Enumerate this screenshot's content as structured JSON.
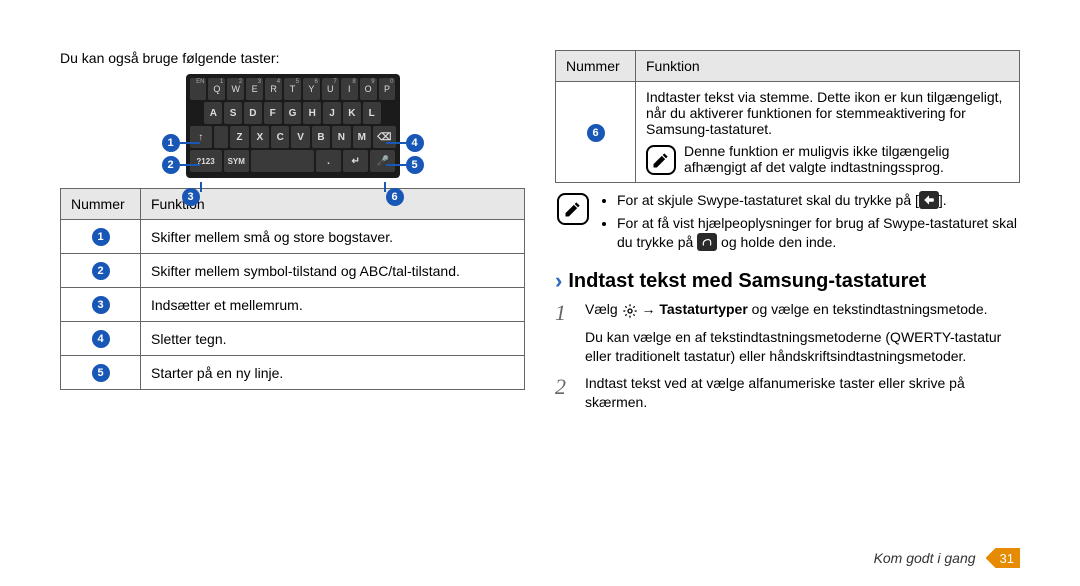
{
  "left": {
    "intro": "Du kan også bruge følgende taster:",
    "kb_rows": {
      "r1_sup": [
        "EN",
        "1",
        "2",
        "3",
        "4",
        "5",
        "6",
        "7",
        "8",
        "9",
        "0"
      ],
      "r1": [
        "",
        "Q",
        "W",
        "E",
        "R",
        "T",
        "Y",
        "U",
        "I",
        "O",
        "P"
      ],
      "r2_sup": [
        "",
        "",
        "#",
        "$",
        "%",
        "^",
        "*",
        "(",
        ")",
        "_"
      ],
      "r2": [
        "A",
        "S",
        "D",
        "F",
        "G",
        "H",
        "J",
        "K",
        "L"
      ],
      "r3": [
        "↑",
        "",
        "Z",
        "X",
        "C",
        "V",
        "B",
        "N",
        "M",
        "⌫"
      ],
      "r4": [
        "?123",
        "SYM",
        "",
        "",
        "",
        "↵",
        "🎤",
        ""
      ]
    },
    "tbl_head": {
      "num": "Nummer",
      "func": "Funktion"
    },
    "rows": [
      {
        "n": "1",
        "text": "Skifter mellem små og store bogstaver."
      },
      {
        "n": "2",
        "text": "Skifter mellem symbol-tilstand og ABC/tal-tilstand."
      },
      {
        "n": "3",
        "text": "Indsætter et mellemrum."
      },
      {
        "n": "4",
        "text": "Sletter tegn."
      },
      {
        "n": "5",
        "text": "Starter på en ny linje."
      }
    ]
  },
  "right": {
    "tbl_head": {
      "num": "Nummer",
      "func": "Funktion"
    },
    "row6": {
      "n": "6",
      "main": "Indtaster tekst via stemme. Dette ikon er kun tilgængeligt, når du aktiverer funktionen for stemmeaktivering for Samsung-tastaturet.",
      "note": "Denne funktion er muligvis ikke tilgængelig afhængigt af det valgte indtastningssprog."
    },
    "tips": {
      "b1a": "For at skjule Swype-tastaturet skal du trykke på [",
      "b1b": "].",
      "b2a": "For at få vist hjælpeoplysninger for brug af Swype-tastaturet skal du trykke på ",
      "b2b": " og holde den inde."
    },
    "section_title": "Indtast tekst med Samsung-tastaturet",
    "step1a": "Vælg ",
    "step1b": " → ",
    "step1_bold": "Tastaturtyper",
    "step1c": " og vælge en tekstindtastningsmetode.",
    "step1_sub": "Du kan vælge en af tekstindtastningsmetoderne (QWERTY-tastatur eller traditionelt tastatur) eller håndskriftsindtastningsmetoder.",
    "step2": "Indtast tekst ved at vælge alfanumeriske taster eller skrive på skærmen."
  },
  "footer": {
    "section": "Kom godt i gang",
    "page": "31"
  }
}
